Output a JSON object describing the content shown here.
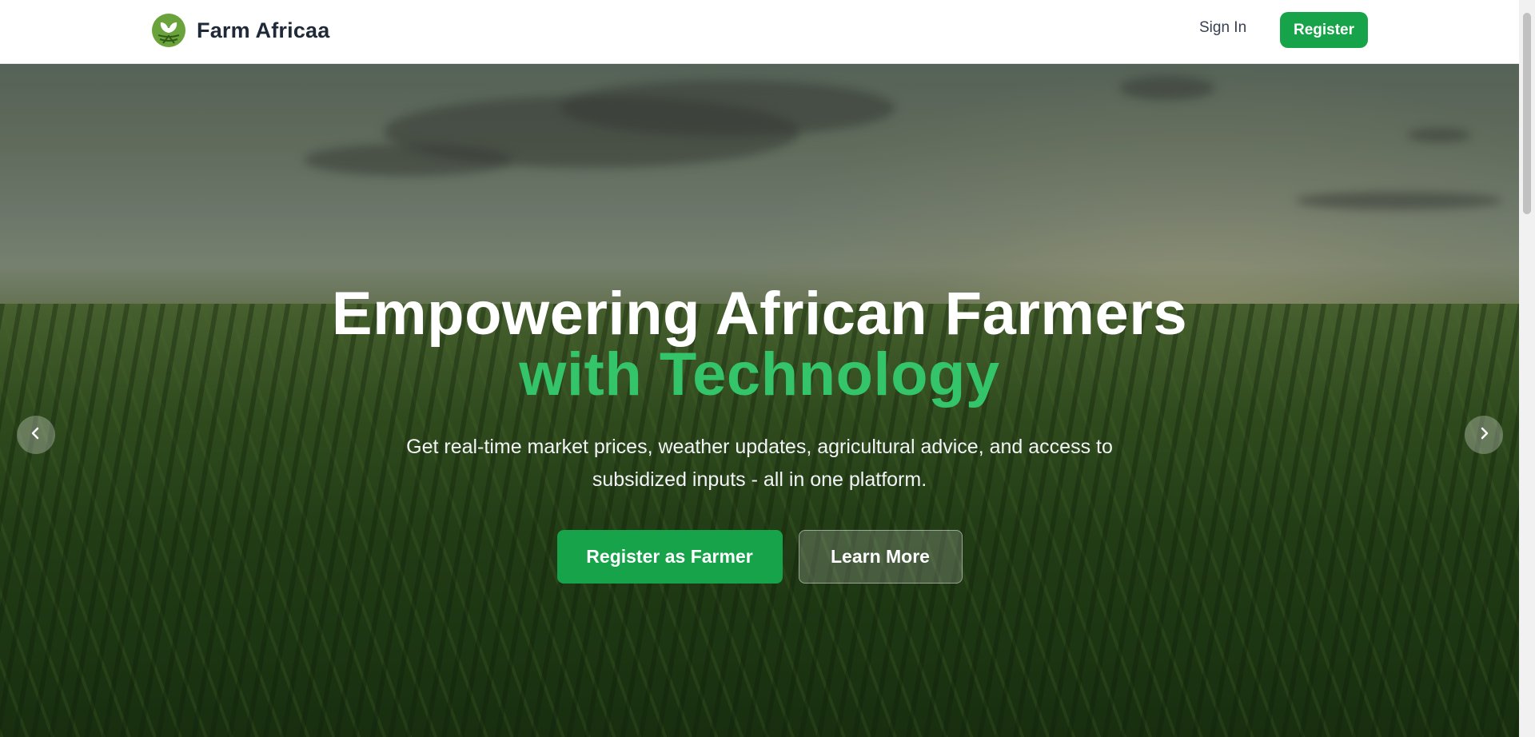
{
  "header": {
    "brand_name": "Farm Africaa",
    "logo_icon": "leaf-sprout-icon",
    "signin_label": "Sign In",
    "register_label": "Register"
  },
  "hero": {
    "title_line1": "Empowering African Farmers",
    "title_line2": "with Technology",
    "subtitle": "Get real-time market prices, weather updates, agricultural advice, and access to subsidized inputs - all in one platform.",
    "primary_cta": "Register as Farmer",
    "secondary_cta": "Learn More",
    "prev_icon": "chevron-left-icon",
    "next_icon": "chevron-right-icon",
    "background_image": "green maize field under cloudy sky"
  },
  "colors": {
    "accent": "#16a34a",
    "highlight_text": "#34c46a",
    "brand_text": "#1f2937"
  }
}
